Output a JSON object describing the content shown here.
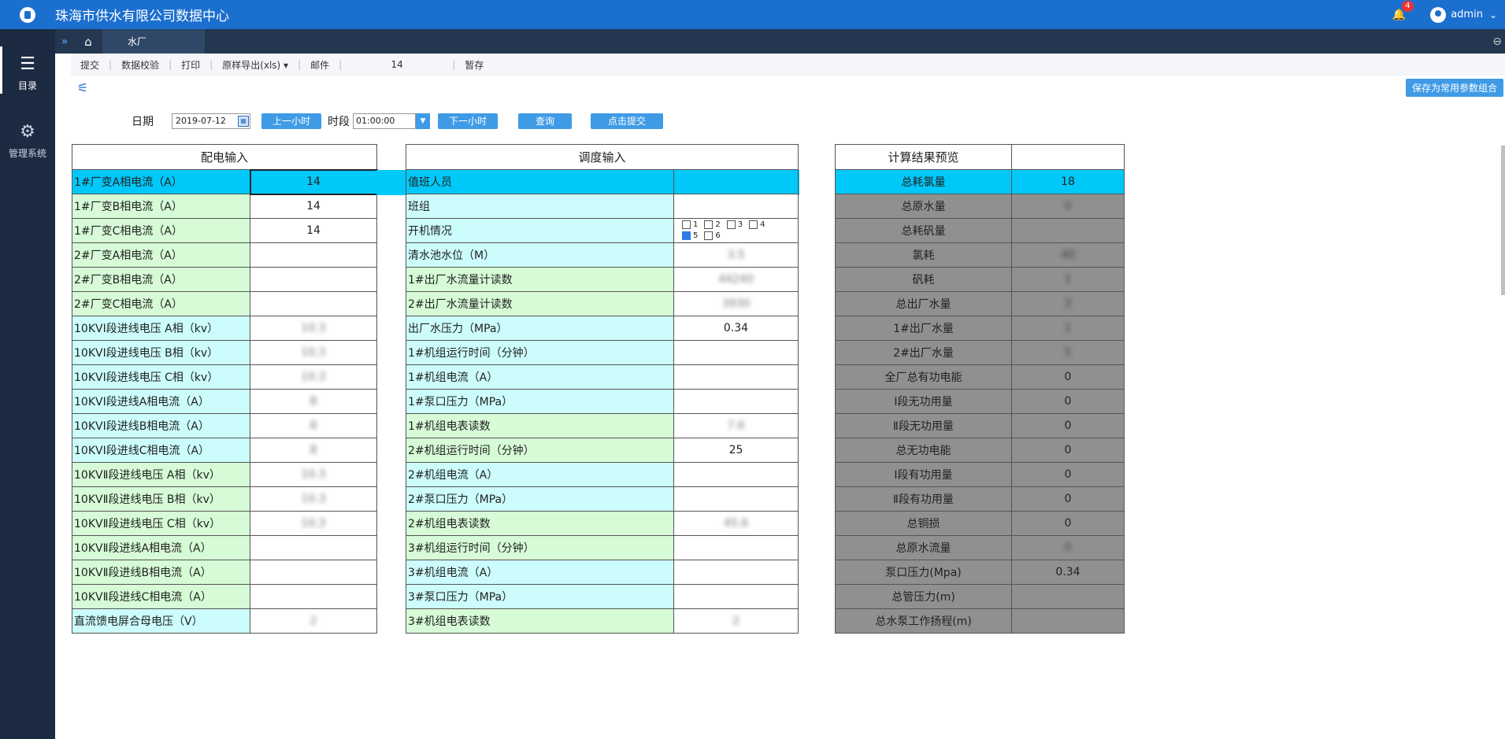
{
  "header": {
    "title": "珠海市供水有限公司数据中心",
    "notification_count": "4",
    "user": "admin"
  },
  "sidebar": {
    "items": [
      {
        "label": "目录",
        "icon": "list-icon"
      },
      {
        "label": "管理系统",
        "icon": "gear-icon"
      }
    ]
  },
  "tabs": {
    "active": "水厂"
  },
  "toolbar": {
    "items": [
      "提交",
      "数据校验",
      "打印",
      "原样导出(xls) ▾",
      "邮件"
    ],
    "count": "14",
    "draft": "暂存"
  },
  "save_combo": "保存为常用参数组合",
  "params": {
    "date_label": "日期",
    "date_value": "2019-07-12",
    "prev_hour": "上一小时",
    "period_label": "时段",
    "time_value": "01:00:00",
    "next_hour": "下一小时",
    "query": "查询",
    "submit": "点击提交"
  },
  "power_input": {
    "title": "配电输入",
    "rows": [
      {
        "label": "1#厂变A相电流（A）",
        "value": "14",
        "color": "hl"
      },
      {
        "label": "1#厂变B相电流（A）",
        "value": "14",
        "color": "g"
      },
      {
        "label": "1#厂变C相电流（A）",
        "value": "14",
        "color": "g"
      },
      {
        "label": "2#厂变A相电流（A）",
        "value": "",
        "color": "g"
      },
      {
        "label": "2#厂变B相电流（A）",
        "value": "",
        "color": "g"
      },
      {
        "label": "2#厂变C相电流（A）",
        "value": "",
        "color": "g"
      },
      {
        "label": "10KVⅠ段进线电压 A相（kv）",
        "value": "10.3",
        "color": "c",
        "blur": true
      },
      {
        "label": "10KVⅠ段进线电压 B相（kv）",
        "value": "10.3",
        "color": "c",
        "blur": true
      },
      {
        "label": "10KVⅠ段进线电压 C相（kv）",
        "value": "10.3",
        "color": "c",
        "blur": true
      },
      {
        "label": "10KVⅠ段进线A相电流（A）",
        "value": "8",
        "color": "c",
        "blur": true
      },
      {
        "label": "10KVⅠ段进线B相电流（A）",
        "value": "8",
        "color": "c",
        "blur": true
      },
      {
        "label": "10KVⅠ段进线C相电流（A）",
        "value": "8",
        "color": "c",
        "blur": true
      },
      {
        "label": "10KVⅡ段进线电压 A相（kv）",
        "value": "10.3",
        "color": "g",
        "blur": true
      },
      {
        "label": "10KVⅡ段进线电压 B相（kv）",
        "value": "10.3",
        "color": "g",
        "blur": true
      },
      {
        "label": "10KVⅡ段进线电压 C相（kv）",
        "value": "10.3",
        "color": "g",
        "blur": true
      },
      {
        "label": "10KVⅡ段进线A相电流（A）",
        "value": "",
        "color": "g"
      },
      {
        "label": "10KVⅡ段进线B相电流（A）",
        "value": "",
        "color": "g"
      },
      {
        "label": "10KVⅡ段进线C相电流（A）",
        "value": "",
        "color": "g"
      },
      {
        "label": "直流馈电屏合母电压（V）",
        "value": "2",
        "color": "c",
        "blur": true
      }
    ]
  },
  "dispatch_input": {
    "title": "调度输入",
    "rows": [
      {
        "label": "值班人员",
        "value": "",
        "color": "hl"
      },
      {
        "label": "班组",
        "value": "",
        "color": "c",
        "gray": true
      },
      {
        "label": "开机情况",
        "value": "",
        "color": "c",
        "checks": true
      },
      {
        "label": "清水池水位（M）",
        "value": "3.5",
        "color": "c",
        "blur": true
      },
      {
        "label": "1#出厂水流量计读数",
        "value": "44240",
        "color": "g",
        "blur": true
      },
      {
        "label": "2#出厂水流量计读数",
        "value": "3930",
        "color": "g",
        "blur": true
      },
      {
        "label": "出厂水压力（MPa）",
        "value": "0.34",
        "color": "c"
      },
      {
        "label": "1#机组运行时间（分钟）",
        "value": "",
        "color": "c"
      },
      {
        "label": "1#机组电流（A）",
        "value": "",
        "color": "c"
      },
      {
        "label": "1#泵口压力（MPa）",
        "value": "",
        "color": "c"
      },
      {
        "label": "1#机组电表读数",
        "value": "7.6",
        "color": "g",
        "blur": true
      },
      {
        "label": "2#机组运行时间（分钟）",
        "value": "25",
        "color": "g"
      },
      {
        "label": "2#机组电流（A）",
        "value": "",
        "color": "c"
      },
      {
        "label": "2#泵口压力（MPa）",
        "value": "",
        "color": "c"
      },
      {
        "label": "2#机组电表读数",
        "value": "45.6",
        "color": "g",
        "blur": true
      },
      {
        "label": "3#机组运行时间（分钟）",
        "value": "",
        "color": "g"
      },
      {
        "label": "3#机组电流（A）",
        "value": "",
        "color": "c"
      },
      {
        "label": "3#泵口压力（MPa）",
        "value": "",
        "color": "c"
      },
      {
        "label": "3#机组电表读数",
        "value": "2",
        "color": "g",
        "blur": true
      }
    ],
    "checkboxes": [
      {
        "label": "1",
        "checked": false
      },
      {
        "label": "2",
        "checked": false
      },
      {
        "label": "3",
        "checked": false
      },
      {
        "label": "4",
        "checked": false
      },
      {
        "label": "5",
        "checked": true
      },
      {
        "label": "6",
        "checked": false
      }
    ]
  },
  "preview": {
    "title": "计算结果预览",
    "rows": [
      {
        "label": "总耗氯量",
        "value": "18",
        "hl": true
      },
      {
        "label": "总原水量",
        "value": "0",
        "blur": true
      },
      {
        "label": "总耗矾量",
        "value": "",
        "blur": true
      },
      {
        "label": "氯耗",
        "value": "40",
        "blur": true
      },
      {
        "label": "矾耗",
        "value": "1",
        "blur": true
      },
      {
        "label": "总出厂水量",
        "value": "3",
        "blur": true
      },
      {
        "label": "1#出厂水量",
        "value": "1",
        "blur": true
      },
      {
        "label": "2#出厂水量",
        "value": "5",
        "blur": true
      },
      {
        "label": "全厂总有功电能",
        "value": "0"
      },
      {
        "label": "Ⅰ段无功用量",
        "value": "0"
      },
      {
        "label": "Ⅱ段无功用量",
        "value": "0"
      },
      {
        "label": "总无功电能",
        "value": "0"
      },
      {
        "label": "Ⅰ段有功用量",
        "value": "0"
      },
      {
        "label": "Ⅱ段有功用量",
        "value": "0"
      },
      {
        "label": "总铜损",
        "value": "0"
      },
      {
        "label": "总原水流量",
        "value": "0",
        "blur": true
      },
      {
        "label": "泵口压力(Mpa)",
        "value": "0.34"
      },
      {
        "label": "总管压力(m)",
        "value": "",
        "blur": true
      },
      {
        "label": "总水泵工作扬程(m)",
        "value": "",
        "blur": true
      }
    ]
  }
}
